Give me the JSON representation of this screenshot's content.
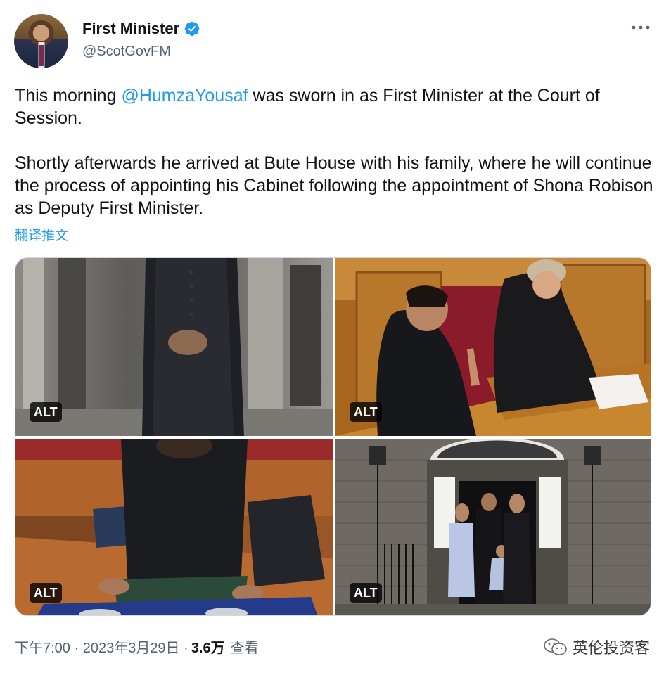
{
  "author": {
    "name": "First Minister",
    "handle": "@ScotGovFM",
    "verified_color": "#1d9bf0"
  },
  "more_icon": "more-horizontal-icon",
  "tweet": {
    "p1_before": "This morning ",
    "p1_mention": "@HumzaYousaf",
    "p1_after": " was sworn in as First Minister at the Court of Session.",
    "p2": "Shortly afterwards he arrived at Bute House with his family, where he will continue the process of appointing his Cabinet following the appointment of Shona Robison as Deputy First Minister."
  },
  "translate_label": "翻译推文",
  "media": {
    "alt_label": "ALT",
    "photos": [
      "photo-1",
      "photo-2",
      "photo-3",
      "photo-4"
    ]
  },
  "footer": {
    "time_date": "下午7:00 · 2023年3月29日 · ",
    "views_count": "3.6万",
    "views_label": "查看"
  },
  "watermark": {
    "text": "英伦投资客",
    "icon": "wechat-icon"
  },
  "colors": {
    "link": "#1d9bf0",
    "text": "#0f1419",
    "secondary": "#536471"
  }
}
